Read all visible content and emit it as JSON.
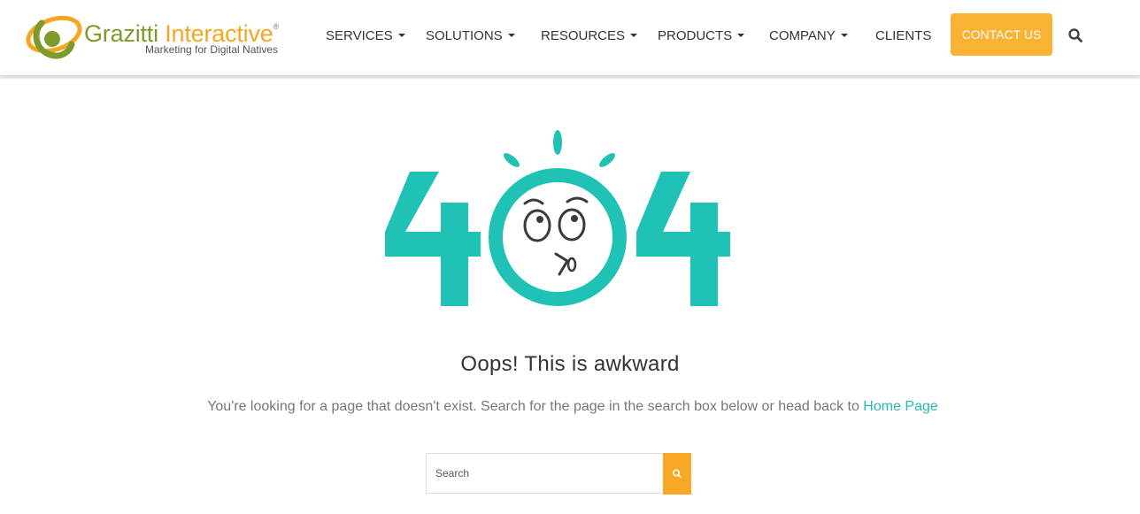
{
  "brand": {
    "name_part1": "Grazitti",
    "name_part2": "Interactive",
    "registered": "®",
    "tagline": "Marketing for Digital Natives",
    "colors": {
      "green": "#7d9a2b",
      "orange": "#f5a623"
    }
  },
  "nav": {
    "items": [
      {
        "label": "SERVICES",
        "dropdown": true
      },
      {
        "label": "SOLUTIONS",
        "dropdown": true
      },
      {
        "label": "RESOURCES",
        "dropdown": true
      },
      {
        "label": "PRODUCTS",
        "dropdown": true
      },
      {
        "label": "COMPANY",
        "dropdown": true
      },
      {
        "label": "CLIENTS",
        "dropdown": false
      }
    ],
    "contact_label": "CONTACT US",
    "search_icon": "search-icon"
  },
  "error": {
    "illustration": "404-surprised-face",
    "code_left": "4",
    "code_right": "4",
    "accent_color": "#20c2b5",
    "heading": "Oops! This is awkward",
    "message": "You're looking for a page that doesn't exist. Search for the page in the search box below or head back to ",
    "home_link": "Home Page"
  },
  "search": {
    "placeholder": "Search",
    "button_icon": "search-icon",
    "button_color": "#f9a825"
  }
}
